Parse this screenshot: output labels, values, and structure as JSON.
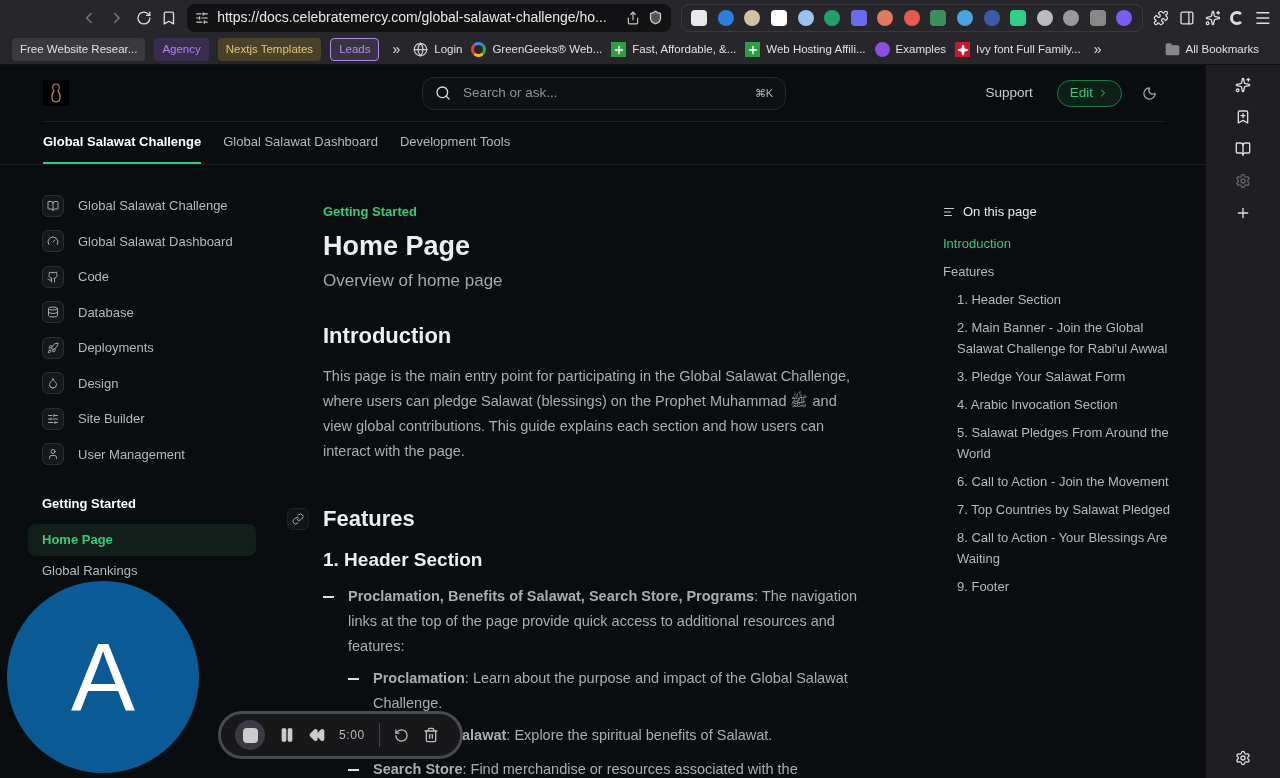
{
  "browser": {
    "url": "https://docs.celebratemercy.com/global-salawat-challenge/ho...",
    "bookmarks": [
      {
        "kind": "chip",
        "label": "Free Website Resear..."
      },
      {
        "kind": "tag",
        "label": "Agency",
        "color": "#3a2c4f"
      },
      {
        "kind": "tag",
        "label": "Nextjs Templates",
        "color": "#4a4128"
      },
      {
        "kind": "outlined_tag",
        "label": "Leads",
        "color": "#b48be6"
      },
      {
        "kind": "more",
        "label": "»"
      },
      {
        "kind": "link",
        "label": "Login"
      },
      {
        "kind": "link",
        "label": "GreenGeeks® Web..."
      },
      {
        "kind": "link",
        "label": "Fast, Affordable, &..."
      },
      {
        "kind": "link",
        "label": "Web Hosting Affili..."
      },
      {
        "kind": "link",
        "label": "Examples"
      },
      {
        "kind": "link",
        "label": "Ivy font Full Family..."
      },
      {
        "kind": "more",
        "label": "»"
      },
      {
        "kind": "folder",
        "label": "All Bookmarks"
      }
    ]
  },
  "header": {
    "search_placeholder": "Search or ask...",
    "shortcut": "⌘K",
    "support": "Support",
    "edit": "Edit"
  },
  "tabs": [
    {
      "label": "Global Salawat Challenge",
      "selected": true
    },
    {
      "label": "Global Salawat Dashboard",
      "selected": false
    },
    {
      "label": "Development Tools",
      "selected": false
    }
  ],
  "sidebar": {
    "groups": [
      {
        "items": [
          {
            "label": "Global Salawat Challenge",
            "selected": false
          },
          {
            "label": "Global Salawat Dashboard",
            "selected": false
          },
          {
            "label": "Code",
            "selected": false
          },
          {
            "label": "Database",
            "selected": false
          },
          {
            "label": "Deployments",
            "selected": false
          },
          {
            "label": "Design",
            "selected": false
          },
          {
            "label": "Site Builder",
            "selected": false
          },
          {
            "label": "User Management",
            "selected": false
          }
        ]
      },
      {
        "heading": "Getting Started",
        "items": [
          {
            "label": "Home Page",
            "selected": true
          },
          {
            "label": "Global Rankings",
            "selected": false
          }
        ]
      }
    ]
  },
  "content": {
    "eyebrow": "Getting Started",
    "title": "Home Page",
    "subtitle": "Overview of home page",
    "introduction": {
      "heading": "Introduction",
      "paragraph": "This page is the main entry point for participating in the Global Salawat Challenge, where users can pledge Salawat (blessings) on the Prophet Muhammad ﷺ and view global contributions. This guide explains each section and how users can interact with the page."
    },
    "features": {
      "heading": "Features",
      "subheading": "1. Header Section",
      "items": [
        {
          "text": "**Proclamation, Benefits of Salawat, Search Store, Programs**: The navigation links at the top of the page provide quick access to additional resources and features:",
          "children": [
            {
              "text": "**Proclamation**: Learn about the purpose and impact of the Global Salawat Challenge.",
              "covered": false
            },
            {
              "text": "**alawat**: Explore the spiritual benefits of Salawat.",
              "covered": true
            },
            {
              "text": "**Search Store**: Find merchandise or resources associated with the",
              "covered": false
            }
          ]
        }
      ]
    }
  },
  "toc": {
    "title": "On this page",
    "items": [
      {
        "label": "Introduction",
        "selected": true
      },
      {
        "label": "Features",
        "selected": false,
        "children": [
          {
            "label": "1. Header Section",
            "selected": false
          },
          {
            "label": "2. Main Banner - Join the Global Salawat Challenge for Rabi'ul Awwal",
            "selected": false
          },
          {
            "label": "3. Pledge Your Salawat Form",
            "selected": false
          },
          {
            "label": "4. Arabic Invocation Section",
            "selected": false
          },
          {
            "label": "5. Salawat Pledges From Around the World",
            "selected": false
          },
          {
            "label": "6. Call to Action - Join the Movement",
            "selected": false
          },
          {
            "label": "7. Top Countries by Salawat Pledged",
            "selected": false
          },
          {
            "label": "8. Call to Action - Your Blessings Are Waiting",
            "selected": false
          },
          {
            "label": "9. Footer",
            "selected": false
          }
        ]
      }
    ]
  },
  "avatar": {
    "letter": "A"
  },
  "recorder": {
    "time": "5:00"
  }
}
